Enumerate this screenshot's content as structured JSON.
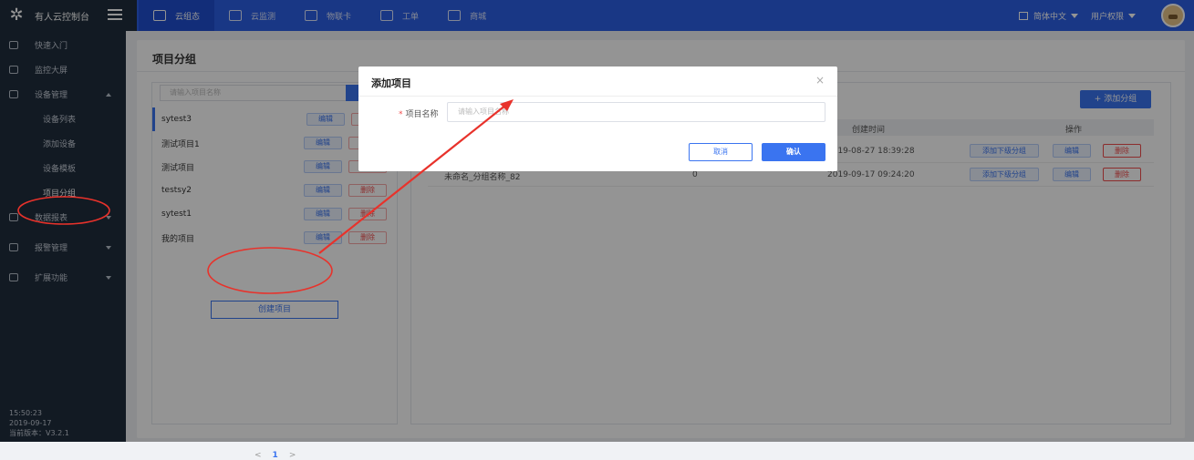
{
  "topbar": {
    "app_title": "有人云控制台",
    "nav": [
      {
        "label": "云组态",
        "icon": "cloud-icon"
      },
      {
        "label": "云监测",
        "icon": "monitor-icon"
      },
      {
        "label": "物联卡",
        "icon": "sim-card-icon"
      },
      {
        "label": "工单",
        "icon": "ticket-icon"
      },
      {
        "label": "商城",
        "icon": "store-icon"
      }
    ],
    "language": "简体中文",
    "user_menu": "用户权限"
  },
  "sidebar": {
    "items": [
      {
        "label": "快速入门",
        "icon": "home-icon"
      },
      {
        "label": "监控大屏",
        "icon": "screen-icon"
      },
      {
        "label": "设备管理",
        "icon": "device-icon"
      },
      {
        "label": "数据报表",
        "icon": "report-icon"
      },
      {
        "label": "报警管理",
        "icon": "alarm-icon"
      },
      {
        "label": "扩展功能",
        "icon": "extension-icon"
      }
    ],
    "sub_items": [
      {
        "label": "设备列表"
      },
      {
        "label": "添加设备"
      },
      {
        "label": "设备模板"
      },
      {
        "label": "项目分组"
      }
    ],
    "footer": {
      "time": "15:50:23",
      "date": "2019-09-17",
      "version": "当前版本：V3.2.1"
    }
  },
  "page": {
    "title": "项目分组",
    "search_placeholder": "请输入项目名称",
    "projects": [
      {
        "name": "sytest3",
        "edit": "编辑",
        "delete": ""
      },
      {
        "name": "测试项目1",
        "edit": "编辑",
        "delete": ""
      },
      {
        "name": "测试项目",
        "edit": "编辑",
        "delete": ""
      },
      {
        "name": "testsy2",
        "edit": "编辑",
        "delete": "删除"
      },
      {
        "name": "sytest1",
        "edit": "编辑",
        "delete": "删除"
      },
      {
        "name": "我的项目",
        "edit": "编辑",
        "delete": "删除"
      }
    ],
    "create_project_label": "创建项目",
    "pager": {
      "prev": "<",
      "current": "1",
      "next": ">"
    },
    "add_group_label": "+ 添加分组",
    "table": {
      "headers": {
        "time": "创建时间",
        "action": "操作"
      },
      "rows": [
        {
          "name": "",
          "count": "",
          "time": "2019-08-27 18:39:28",
          "add_sub": "添加下级分组",
          "edit": "编辑",
          "delete": "删除"
        },
        {
          "name": "未命名_分组名称_82",
          "count": "0",
          "time": "2019-09-17 09:24:20",
          "add_sub": "添加下级分组",
          "edit": "编辑",
          "delete": "删除"
        }
      ]
    }
  },
  "modal": {
    "title": "添加项目",
    "close": "×",
    "field_label": "项目名称",
    "field_required_mark": "*",
    "field_placeholder": "请输入项目名称",
    "cancel_label": "取消",
    "confirm_label": "确认"
  },
  "colors": {
    "topbar": "#2c5fe6",
    "sidebar": "#1f2d3d",
    "primary": "#3a74f0",
    "danger": "#f24c4c",
    "annotation": "#e8322b"
  }
}
